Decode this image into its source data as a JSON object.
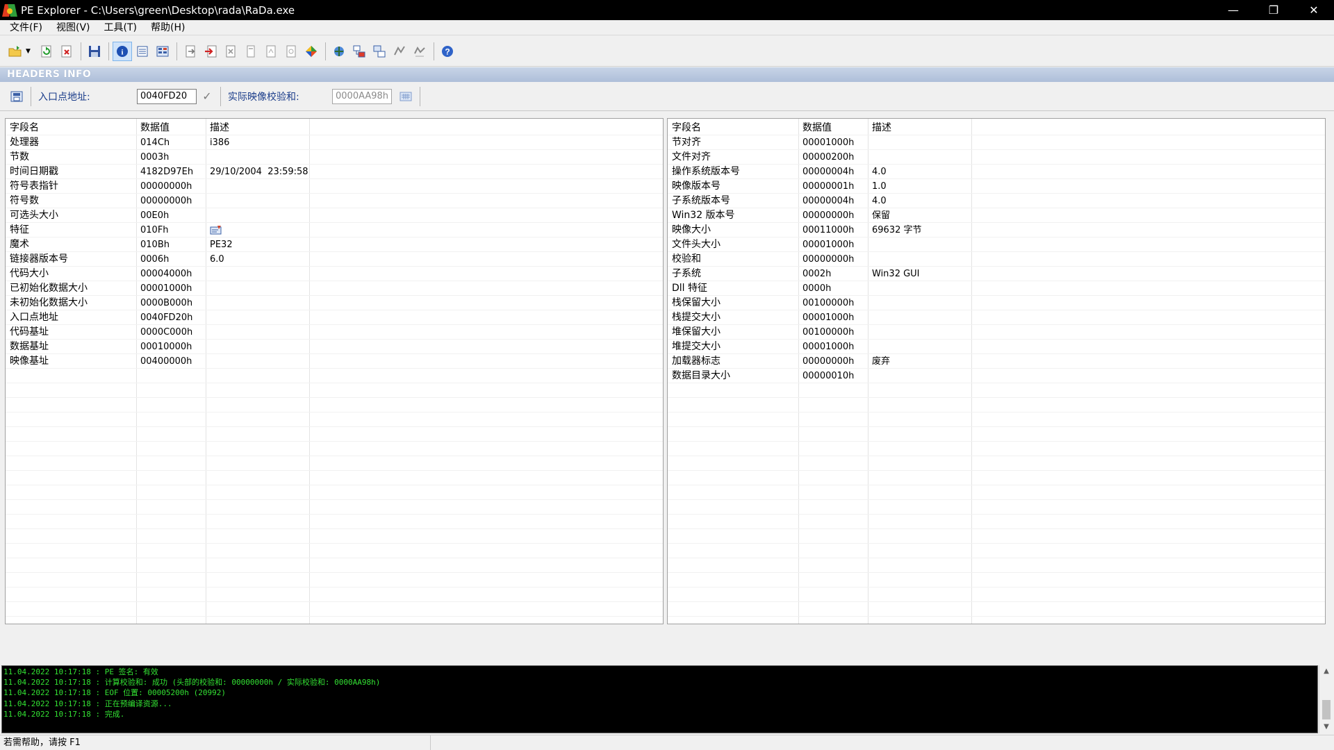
{
  "window": {
    "title": "PE Explorer - C:\\Users\\green\\Desktop\\rada\\RaDa.exe",
    "controls": {
      "minimize": "—",
      "restore": "❐",
      "close": "✕"
    }
  },
  "menu": [
    "文件(F)",
    "视图(V)",
    "工具(T)",
    "帮助(H)"
  ],
  "toolbar": {
    "icons": [
      "open-folder-icon",
      "dropdown-arrow-icon",
      "reload-icon",
      "close-file-icon",
      "save-icon",
      "headers-info-icon",
      "data-directories-icon",
      "section-headers-icon",
      "exports-icon",
      "imports-icon",
      "resources-icon",
      "debug-icon",
      "relocations-icon",
      "tls-icon",
      "disassembler-icon",
      "dependency-scanner-icon",
      "resource-editor-icon",
      "section-editor-icon",
      "signature-icon",
      "help-icon"
    ]
  },
  "section_header": "HEADERS INFO",
  "infobar": {
    "entry_label": "入口点地址:",
    "entry_value": "0040FD20",
    "checksum_label": "实际映像校验和:",
    "checksum_value": "0000AA98h"
  },
  "left_table": {
    "headers": [
      "字段名",
      "数据值",
      "描述"
    ],
    "rows": [
      [
        "处理器",
        "014Ch",
        "i386"
      ],
      [
        "节数",
        "0003h",
        ""
      ],
      [
        "时间日期戳",
        "4182D97Eh",
        "29/10/2004  23:59:58"
      ],
      [
        "符号表指针",
        "00000000h",
        ""
      ],
      [
        "符号数",
        "00000000h",
        ""
      ],
      [
        "可选头大小",
        "00E0h",
        ""
      ],
      [
        "特征",
        "010Fh",
        ""
      ],
      [
        "魔术",
        "010Bh",
        "PE32"
      ],
      [
        "链接器版本号",
        "0006h",
        "6.0"
      ],
      [
        "代码大小",
        "00004000h",
        ""
      ],
      [
        "已初始化数据大小",
        "00001000h",
        ""
      ],
      [
        "未初始化数据大小",
        "0000B000h",
        ""
      ],
      [
        "入口点地址",
        "0040FD20h",
        ""
      ],
      [
        "代码基址",
        "0000C000h",
        ""
      ],
      [
        "数据基址",
        "00010000h",
        ""
      ],
      [
        "映像基址",
        "00400000h",
        ""
      ]
    ]
  },
  "right_table": {
    "headers": [
      "字段名",
      "数据值",
      "描述"
    ],
    "rows": [
      [
        "节对齐",
        "00001000h",
        ""
      ],
      [
        "文件对齐",
        "00000200h",
        ""
      ],
      [
        "操作系统版本号",
        "00000004h",
        "4.0"
      ],
      [
        "映像版本号",
        "00000001h",
        "1.0"
      ],
      [
        "子系统版本号",
        "00000004h",
        "4.0"
      ],
      [
        "Win32 版本号",
        "00000000h",
        "保留"
      ],
      [
        "映像大小",
        "00011000h",
        "69632 字节"
      ],
      [
        "文件头大小",
        "00001000h",
        ""
      ],
      [
        "校验和",
        "00000000h",
        ""
      ],
      [
        "子系统",
        "0002h",
        "Win32 GUI"
      ],
      [
        "Dll 特征",
        "0000h",
        ""
      ],
      [
        "栈保留大小",
        "00100000h",
        ""
      ],
      [
        "栈提交大小",
        "00001000h",
        ""
      ],
      [
        "堆保留大小",
        "00100000h",
        ""
      ],
      [
        "堆提交大小",
        "00001000h",
        ""
      ],
      [
        "加载器标志",
        "00000000h",
        "废弃"
      ],
      [
        "数据目录大小",
        "00000010h",
        ""
      ]
    ]
  },
  "log": [
    "11.04.2022 10:17:18 : PE 签名: 有效",
    "11.04.2022 10:17:18 : 计算校验和: 成功 (头部的校验和: 00000000h / 实际校验和: 0000AA98h)",
    "11.04.2022 10:17:18 : EOF 位置: 00005200h  (20992)",
    "11.04.2022 10:17:18 : 正在预编译资源...",
    "11.04.2022 10:17:18 : 完成."
  ],
  "status": "若需帮助，请按 F1",
  "colors": {
    "log_text": "#33e233",
    "label_blue": "#1a3c8a",
    "header_band": "#b8c8e0"
  }
}
